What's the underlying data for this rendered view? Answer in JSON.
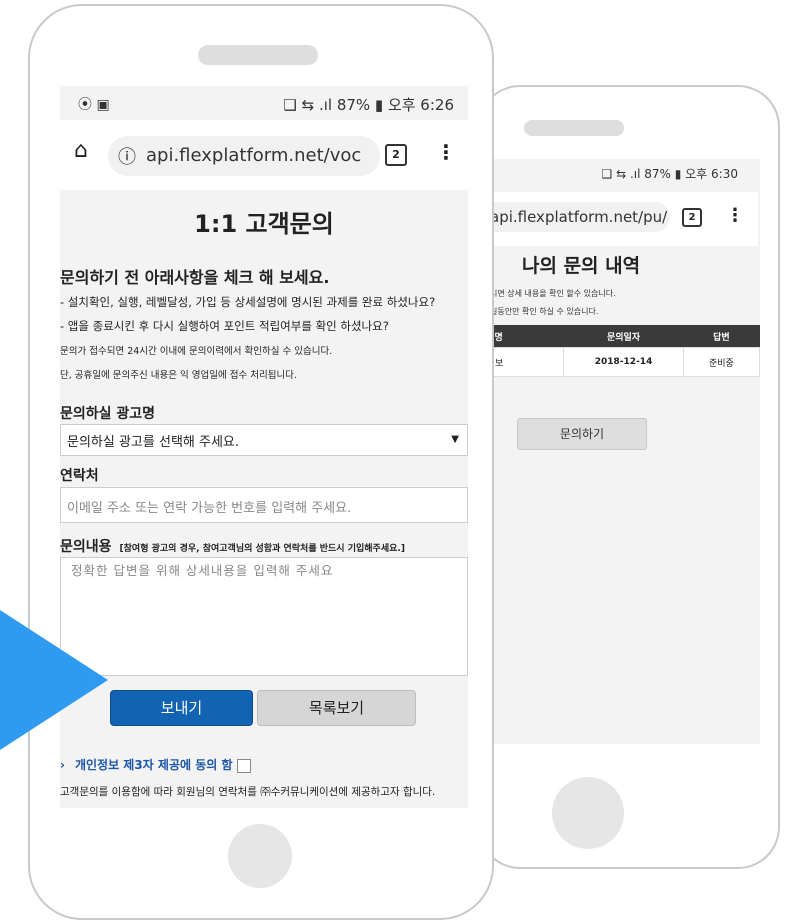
{
  "back_phone": {
    "status": "❑ ⇆ .ıl 87% ▮ 오후 6:30",
    "url": "api.flexplatform.net/pu/",
    "tab_count": "2",
    "title": "나의 문의 내역",
    "note1": "시면 상세 내용을 확인 할수 있습니다.",
    "note2": "일동안만 확인 하실 수 있습니다.",
    "table": {
      "headers": [
        "명",
        "문의일자",
        "답변"
      ],
      "rows": [
        [
          "보",
          "2018-12-14",
          "준비중"
        ]
      ]
    },
    "inquiry_button": "문의하기"
  },
  "front_phone": {
    "status": {
      "left_icons": "⦿ ▣",
      "right": "❑ ⇆ .ıl 87% ▮ 오후 6:26"
    },
    "address_bar": {
      "url": "api.flexplatform.net/voc",
      "tab_count": "2"
    },
    "title": "1:1 고객문의",
    "heading": "문의하기 전 아래사항을 체크 해 보세요.",
    "checklist": [
      "- 설치확인, 실행, 레벨달성, 가입 등 상세설명에 명시된 과제를 완료 하셨나요?",
      "- 앱을 종료시킨 후 다시 실행하여 포인트 적립여부를 확인 하셨나요?",
      "문의가 접수되면 24시간 이내에 문의이력에서 확인하실 수 있습니다.",
      "단, 공휴일에 문의주신 내용은 익 영업일에 접수 처리됩니다."
    ],
    "ad_label": "문의하실 광고명",
    "ad_select_value": "문의하실 광고를 선택해 주세요.",
    "contact_label": "연락처",
    "contact_placeholder": "이메일 주소 또는 연락 가능한 번호를 입력해 주세요.",
    "content_label": "문의내용",
    "content_sublabel": "[참여형 광고의 경우, 참여고객님의 성함과 연락처를 반드시 기입해주세요.]",
    "content_placeholder": "정확한 답변을 위해 상세내용을 입력해 주세요",
    "send_button": "보내기",
    "list_button": "목록보기",
    "consent_label": "개인정보 제3자 제공에 동의 함",
    "consent_desc": "고객문의를 이용함에 따라 회원님의 연락처를 ㈜수커뮤니케이션에 제공하고자 합니다."
  },
  "colors": {
    "send_button": "#1363b3",
    "arrow": "#2f9bf0",
    "consent_text": "#1a56a8"
  },
  "icons": [
    "home-icon",
    "info-icon",
    "tab-switcher-icon",
    "more-menu-icon",
    "dropdown-arrow-icon",
    "checkbox-icon",
    "pointer-arrow"
  ]
}
